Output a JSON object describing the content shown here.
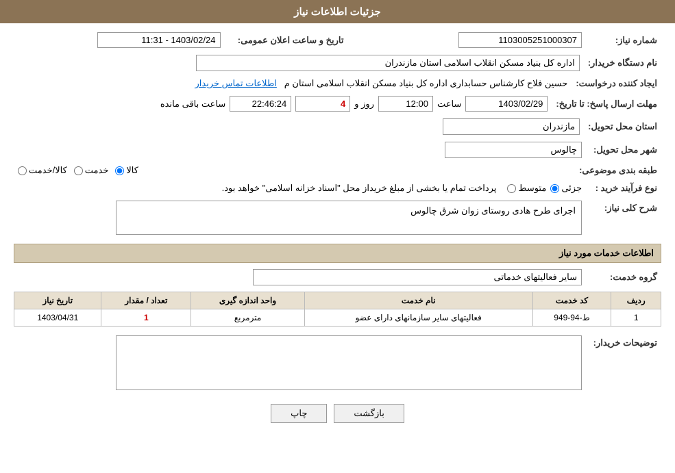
{
  "header": {
    "title": "جزئیات اطلاعات نیاز"
  },
  "fields": {
    "شماره_نیاز_label": "شماره نیاز:",
    "شماره_نیاز_value": "1103005251000307",
    "تاریخ_label": "تاریخ و ساعت اعلان عمومی:",
    "تاریخ_value": "1403/02/24 - 11:31",
    "نام_دستگاه_label": "نام دستگاه خریدار:",
    "نام_دستگاه_value": "اداره کل بنیاد مسکن انقلاب اسلامی استان مازندران",
    "ایجاد_کننده_label": "ایجاد کننده درخواست:",
    "ایجاد_کننده_value": "حسین فلاح کارشناس حسابداری اداره کل بنیاد مسکن انقلاب اسلامی استان م",
    "اطلاعات_تماس_link": "اطلاعات تماس خریدار",
    "مهلت_ارسال_label": "مهلت ارسال پاسخ: تا تاریخ:",
    "مهلت_تاریخ_value": "1403/02/29",
    "مهلت_ساعت_label": "ساعت",
    "مهلت_ساعت_value": "12:00",
    "مهلت_روز_label": "روز و",
    "مهلت_روز_value": "4",
    "مهلت_باقی_label": "ساعت باقی مانده",
    "مهلت_باقی_value": "22:46:24",
    "استان_label": "استان محل تحویل:",
    "استان_value": "مازندران",
    "شهر_label": "شهر محل تحویل:",
    "شهر_value": "چالوس",
    "طبقه_بندی_label": "طبقه بندی موضوعی:",
    "کالا_radio": "کالا",
    "خدمت_radio": "خدمت",
    "کالا_خدمت_radio": "کالا/خدمت",
    "نوع_فرآیند_label": "نوع فرآیند خرید :",
    "جزئی_radio": "جزئی",
    "متوسط_radio": "متوسط",
    "نوع_فرآیند_desc": "پرداخت تمام یا بخشی از مبلغ خریداز محل \"اسناد خزانه اسلامی\" خواهد بود.",
    "شرح_کلی_label": "شرح کلی نیاز:",
    "شرح_کلی_value": "اجرای طرح هادی روستای زوان شرق چالوس",
    "اطلاعات_خدمات_title": "اطلاعات خدمات مورد نیاز",
    "گروه_خدمت_label": "گروه خدمت:",
    "گروه_خدمت_value": "سایر فعالیتهای خدماتی",
    "table": {
      "headers": [
        "ردیف",
        "کد خدمت",
        "نام خدمت",
        "واحد اندازه گیری",
        "تعداد / مقدار",
        "تاریخ نیاز"
      ],
      "rows": [
        {
          "ردیف": "1",
          "کد_خدمت": "ط-94-949",
          "نام_خدمت": "فعالیتهای سایر سازمانهای دارای عضو",
          "واحد": "مترمربع",
          "تعداد": "1",
          "تاریخ": "1403/04/31"
        }
      ]
    },
    "توضیحات_label": "توضیحات خریدار:",
    "توضیحات_value": ""
  },
  "buttons": {
    "print_label": "چاپ",
    "back_label": "بازگشت"
  }
}
